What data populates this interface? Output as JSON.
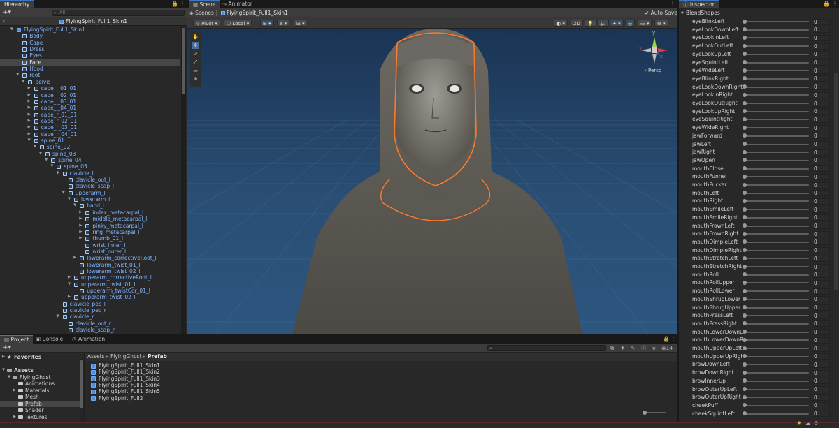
{
  "hierarchy": {
    "tab": "Hierarchy",
    "search_placeholder": "All",
    "prefab_title": "FlyingSpirit_Full1_Skin1",
    "rows": [
      {
        "label": "FlyingSpirit_Full1_Skin1",
        "depth": 0,
        "arrow": "▼"
      },
      {
        "label": "Body",
        "depth": 1,
        "arrow": ""
      },
      {
        "label": "Cape",
        "depth": 1,
        "arrow": ""
      },
      {
        "label": "Dress",
        "depth": 1,
        "arrow": ""
      },
      {
        "label": "Eyes",
        "depth": 1,
        "arrow": ""
      },
      {
        "label": "Face",
        "depth": 1,
        "arrow": "",
        "selected": true
      },
      {
        "label": "Hood",
        "depth": 1,
        "arrow": ""
      },
      {
        "label": "root",
        "depth": 1,
        "arrow": "▼"
      },
      {
        "label": "pelvis",
        "depth": 2,
        "arrow": "▼"
      },
      {
        "label": "cape_l_01_01",
        "depth": 3,
        "arrow": "▶"
      },
      {
        "label": "cape_l_02_01",
        "depth": 3,
        "arrow": "▶"
      },
      {
        "label": "cape_l_03_01",
        "depth": 3,
        "arrow": "▶"
      },
      {
        "label": "cape_l_04_01",
        "depth": 3,
        "arrow": "▶"
      },
      {
        "label": "cape_r_01_01",
        "depth": 3,
        "arrow": "▶"
      },
      {
        "label": "cape_r_02_01",
        "depth": 3,
        "arrow": "▶"
      },
      {
        "label": "cape_r_03_01",
        "depth": 3,
        "arrow": "▶"
      },
      {
        "label": "cape_r_04_01",
        "depth": 3,
        "arrow": "▶"
      },
      {
        "label": "spine_01",
        "depth": 3,
        "arrow": "▼"
      },
      {
        "label": "spine_02",
        "depth": 4,
        "arrow": "▼"
      },
      {
        "label": "spine_03",
        "depth": 5,
        "arrow": "▼"
      },
      {
        "label": "spine_04",
        "depth": 6,
        "arrow": "▼"
      },
      {
        "label": "spine_05",
        "depth": 7,
        "arrow": "▼"
      },
      {
        "label": "clavicle_l",
        "depth": 8,
        "arrow": "▼"
      },
      {
        "label": "clavicle_out_l",
        "depth": 9,
        "arrow": ""
      },
      {
        "label": "clavicle_scap_l",
        "depth": 9,
        "arrow": ""
      },
      {
        "label": "upperarm_l",
        "depth": 9,
        "arrow": "▼"
      },
      {
        "label": "lowerarm_l",
        "depth": 10,
        "arrow": "▼"
      },
      {
        "label": "hand_l",
        "depth": 11,
        "arrow": "▼"
      },
      {
        "label": "index_metacarpal_l",
        "depth": 12,
        "arrow": "▶"
      },
      {
        "label": "middle_metacarpal_l",
        "depth": 12,
        "arrow": "▶"
      },
      {
        "label": "pinky_metacarpal_l",
        "depth": 12,
        "arrow": "▶"
      },
      {
        "label": "ring_metacarpal_l",
        "depth": 12,
        "arrow": "▶"
      },
      {
        "label": "thumb_01_l",
        "depth": 12,
        "arrow": "▶"
      },
      {
        "label": "wrist_inner_l",
        "depth": 12,
        "arrow": ""
      },
      {
        "label": "wrist_outer_l",
        "depth": 12,
        "arrow": ""
      },
      {
        "label": "lowerarm_correctiveRoot_l",
        "depth": 11,
        "arrow": "▶"
      },
      {
        "label": "lowerarm_twist_01_l",
        "depth": 11,
        "arrow": ""
      },
      {
        "label": "lowerarm_twist_02_l",
        "depth": 11,
        "arrow": ""
      },
      {
        "label": "upperarm_correctiveRoot_l",
        "depth": 10,
        "arrow": "▶"
      },
      {
        "label": "upperarm_twist_01_l",
        "depth": 10,
        "arrow": "▼"
      },
      {
        "label": "upperarm_twistCor_01_l",
        "depth": 11,
        "arrow": ""
      },
      {
        "label": "upperarm_twist_02_l",
        "depth": 10,
        "arrow": "▶"
      },
      {
        "label": "clavicle_pec_l",
        "depth": 8,
        "arrow": ""
      },
      {
        "label": "clavicle_pec_r",
        "depth": 8,
        "arrow": ""
      },
      {
        "label": "clavicle_r",
        "depth": 8,
        "arrow": "▼"
      },
      {
        "label": "clavicle_out_r",
        "depth": 9,
        "arrow": ""
      },
      {
        "label": "clavicle_scap_r",
        "depth": 9,
        "arrow": ""
      }
    ]
  },
  "scene": {
    "tabs": [
      "Scene",
      "Animator"
    ],
    "scenes_label": "Scenes",
    "prefab_crumb": "FlyingSpirit_Full1_Skin1",
    "auto_save_label": "Auto Save",
    "pivot_label": "Pivot",
    "local_label": "Local",
    "mode_2d": "2D",
    "persp_label": "Persp",
    "gizmo_axes": [
      "y",
      "x",
      "z"
    ]
  },
  "inspector": {
    "tab": "Inspector",
    "section": "BlendShapes",
    "blendshapes": [
      {
        "name": "eyeBlinkLeft",
        "value": "0"
      },
      {
        "name": "eyeLookDownLeft",
        "value": "0"
      },
      {
        "name": "eyeLookInLeft",
        "value": "0"
      },
      {
        "name": "eyeLookOutLeft",
        "value": "0"
      },
      {
        "name": "eyeLookUpLeft",
        "value": "0"
      },
      {
        "name": "eyeSquintLeft",
        "value": "0"
      },
      {
        "name": "eyeWideLeft",
        "value": "0"
      },
      {
        "name": "eyeBlinkRight",
        "value": "0"
      },
      {
        "name": "eyeLookDownRight",
        "value": "0"
      },
      {
        "name": "eyeLookInRight",
        "value": "0"
      },
      {
        "name": "eyeLookOutRight",
        "value": "0"
      },
      {
        "name": "eyeLookUpRight",
        "value": "0"
      },
      {
        "name": "eyeSquintRight",
        "value": "0"
      },
      {
        "name": "eyeWideRight",
        "value": "0"
      },
      {
        "name": "jawForward",
        "value": "0"
      },
      {
        "name": "jawLeft",
        "value": "0"
      },
      {
        "name": "jawRight",
        "value": "0"
      },
      {
        "name": "jawOpen",
        "value": "0"
      },
      {
        "name": "mouthClose",
        "value": "0"
      },
      {
        "name": "mouthFunnel",
        "value": "0"
      },
      {
        "name": "mouthPucker",
        "value": "0"
      },
      {
        "name": "mouthLeft",
        "value": "0"
      },
      {
        "name": "mouthRight",
        "value": "0"
      },
      {
        "name": "mouthSmileLeft",
        "value": "0"
      },
      {
        "name": "mouthSmileRight",
        "value": "0"
      },
      {
        "name": "mouthFrownLeft",
        "value": "0"
      },
      {
        "name": "mouthFrownRight",
        "value": "0"
      },
      {
        "name": "mouthDimpleLeft",
        "value": "0"
      },
      {
        "name": "mouthDimpleRight",
        "value": "0"
      },
      {
        "name": "mouthStretchLeft",
        "value": "0"
      },
      {
        "name": "mouthStretchRight",
        "value": "0"
      },
      {
        "name": "mouthRoll",
        "value": "0"
      },
      {
        "name": "mouthRollUpper",
        "value": "0"
      },
      {
        "name": "mouthRollLower",
        "value": "0"
      },
      {
        "name": "mouthShrugLower",
        "value": "0"
      },
      {
        "name": "mouthShrugUpper",
        "value": "0"
      },
      {
        "name": "mouthPressLeft",
        "value": "0"
      },
      {
        "name": "mouthPressRight",
        "value": "0"
      },
      {
        "name": "mouthLowerDownLeft",
        "value": "0"
      },
      {
        "name": "mouthLowerDownRight",
        "value": "0"
      },
      {
        "name": "mouthUpperUpLeft",
        "value": "0"
      },
      {
        "name": "mouthUpperUpRight",
        "value": "0"
      },
      {
        "name": "browDownLeft",
        "value": "0"
      },
      {
        "name": "browDownRight",
        "value": "0"
      },
      {
        "name": "browInnerUp",
        "value": "0"
      },
      {
        "name": "browOuterUpLeft",
        "value": "0"
      },
      {
        "name": "browOuterUpRight",
        "value": "0"
      },
      {
        "name": "cheekPuff",
        "value": "0"
      },
      {
        "name": "cheekSquintLeft",
        "value": "0"
      }
    ]
  },
  "project": {
    "tabs": [
      "Project",
      "Console",
      "Animation"
    ],
    "hidden_count": "14",
    "favorites_label": "Favorites",
    "tree": [
      {
        "label": "Assets",
        "depth": 0,
        "arrow": "▼",
        "bold": true
      },
      {
        "label": "FlyingGhost",
        "depth": 1,
        "arrow": "▼"
      },
      {
        "label": "Animations",
        "depth": 2,
        "arrow": ""
      },
      {
        "label": "Materials",
        "depth": 2,
        "arrow": "▶"
      },
      {
        "label": "Mesh",
        "depth": 2,
        "arrow": ""
      },
      {
        "label": "Prefab",
        "depth": 2,
        "arrow": "",
        "selected": true
      },
      {
        "label": "Shader",
        "depth": 2,
        "arrow": ""
      },
      {
        "label": "Textures",
        "depth": 2,
        "arrow": "▶"
      }
    ],
    "breadcrumb": [
      "Assets",
      "FlyingGhost",
      "Prefab"
    ],
    "assets": [
      "FlyingSpirit_Full1_Skin1",
      "FlyingSpirit_Full1_Skin2",
      "FlyingSpirit_Full1_Skin3",
      "FlyingSpirit_Full1_Skin4",
      "FlyingSpirit_Full1_Skin5",
      "FlyingSpirit_Full2"
    ]
  }
}
